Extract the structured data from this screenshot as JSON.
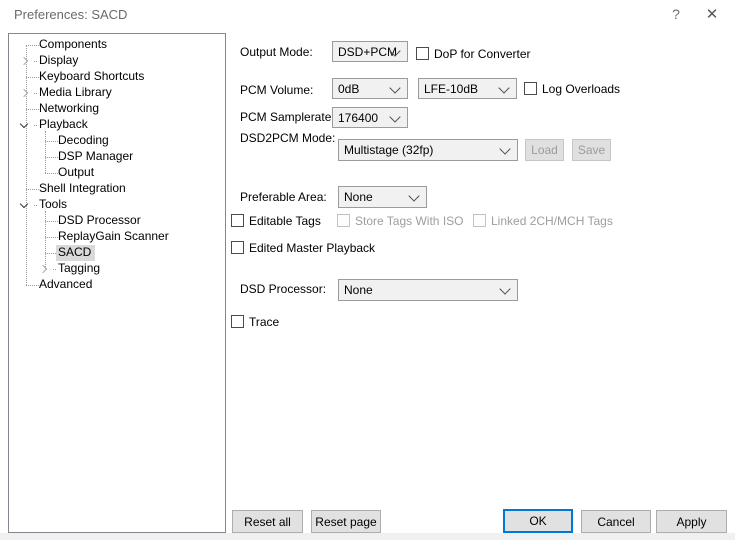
{
  "window": {
    "title": "Preferences: SACD",
    "help_glyph": "?",
    "close_glyph": "✕"
  },
  "sidebar": {
    "items": [
      {
        "label": "Components",
        "level": 0,
        "chevron": "none",
        "selected": false
      },
      {
        "label": "Display",
        "level": 0,
        "chevron": "collapsed",
        "selected": false
      },
      {
        "label": "Keyboard Shortcuts",
        "level": 0,
        "chevron": "none",
        "selected": false
      },
      {
        "label": "Media Library",
        "level": 0,
        "chevron": "collapsed",
        "selected": false
      },
      {
        "label": "Networking",
        "level": 0,
        "chevron": "none",
        "selected": false
      },
      {
        "label": "Playback",
        "level": 0,
        "chevron": "expanded",
        "selected": false
      },
      {
        "label": "Decoding",
        "level": 1,
        "chevron": "none",
        "selected": false
      },
      {
        "label": "DSP Manager",
        "level": 1,
        "chevron": "none",
        "selected": false
      },
      {
        "label": "Output",
        "level": 1,
        "chevron": "none",
        "selected": false
      },
      {
        "label": "Shell Integration",
        "level": 0,
        "chevron": "none",
        "selected": false
      },
      {
        "label": "Tools",
        "level": 0,
        "chevron": "expanded",
        "selected": false
      },
      {
        "label": "DSD Processor",
        "level": 1,
        "chevron": "none",
        "selected": false
      },
      {
        "label": "ReplayGain Scanner",
        "level": 1,
        "chevron": "none",
        "selected": false
      },
      {
        "label": "SACD",
        "level": 1,
        "chevron": "none",
        "selected": true
      },
      {
        "label": "Tagging",
        "level": 1,
        "chevron": "collapsed",
        "selected": false
      },
      {
        "label": "Advanced",
        "level": 0,
        "chevron": "none",
        "selected": false
      }
    ]
  },
  "main": {
    "output_mode": {
      "label": "Output Mode:",
      "value": "DSD+PCM"
    },
    "dop_for_converter": {
      "label": "DoP for Converter",
      "checked": false
    },
    "pcm_volume": {
      "label": "PCM Volume:",
      "value": "0dB",
      "lfe_value": "LFE-10dB"
    },
    "log_overloads": {
      "label": "Log Overloads",
      "checked": false
    },
    "pcm_samplerate": {
      "label": "PCM Samplerate:",
      "value": "176400"
    },
    "dsd2pcm_mode": {
      "label": "DSD2PCM Mode:",
      "value": "Multistage (32fp)",
      "load_label": "Load",
      "save_label": "Save"
    },
    "preferable_area": {
      "label": "Preferable Area:",
      "value": "None"
    },
    "editable_tags": {
      "label": "Editable Tags",
      "checked": false
    },
    "store_tags_with_iso": {
      "label": "Store Tags With ISO",
      "checked": false,
      "disabled": true
    },
    "linked_tags": {
      "label": "Linked 2CH/MCH Tags",
      "checked": false,
      "disabled": true
    },
    "edited_master_playback": {
      "label": "Edited Master Playback",
      "checked": false
    },
    "dsd_processor": {
      "label": "DSD Processor:",
      "value": "None"
    },
    "trace": {
      "label": "Trace",
      "checked": false
    }
  },
  "footer": {
    "reset_all": "Reset all",
    "reset_page": "Reset page",
    "ok": "OK",
    "cancel": "Cancel",
    "apply": "Apply"
  },
  "colors": {
    "focus_accent": "#0078d7",
    "tree_selection_bg": "#d9d9d9",
    "disabled_text": "#9d9d9d",
    "control_bg": "#f1f1f1",
    "button_bg": "#e1e1e1",
    "title_text": "#6b6b6b",
    "bottom_strip": "#f0f0f0"
  }
}
